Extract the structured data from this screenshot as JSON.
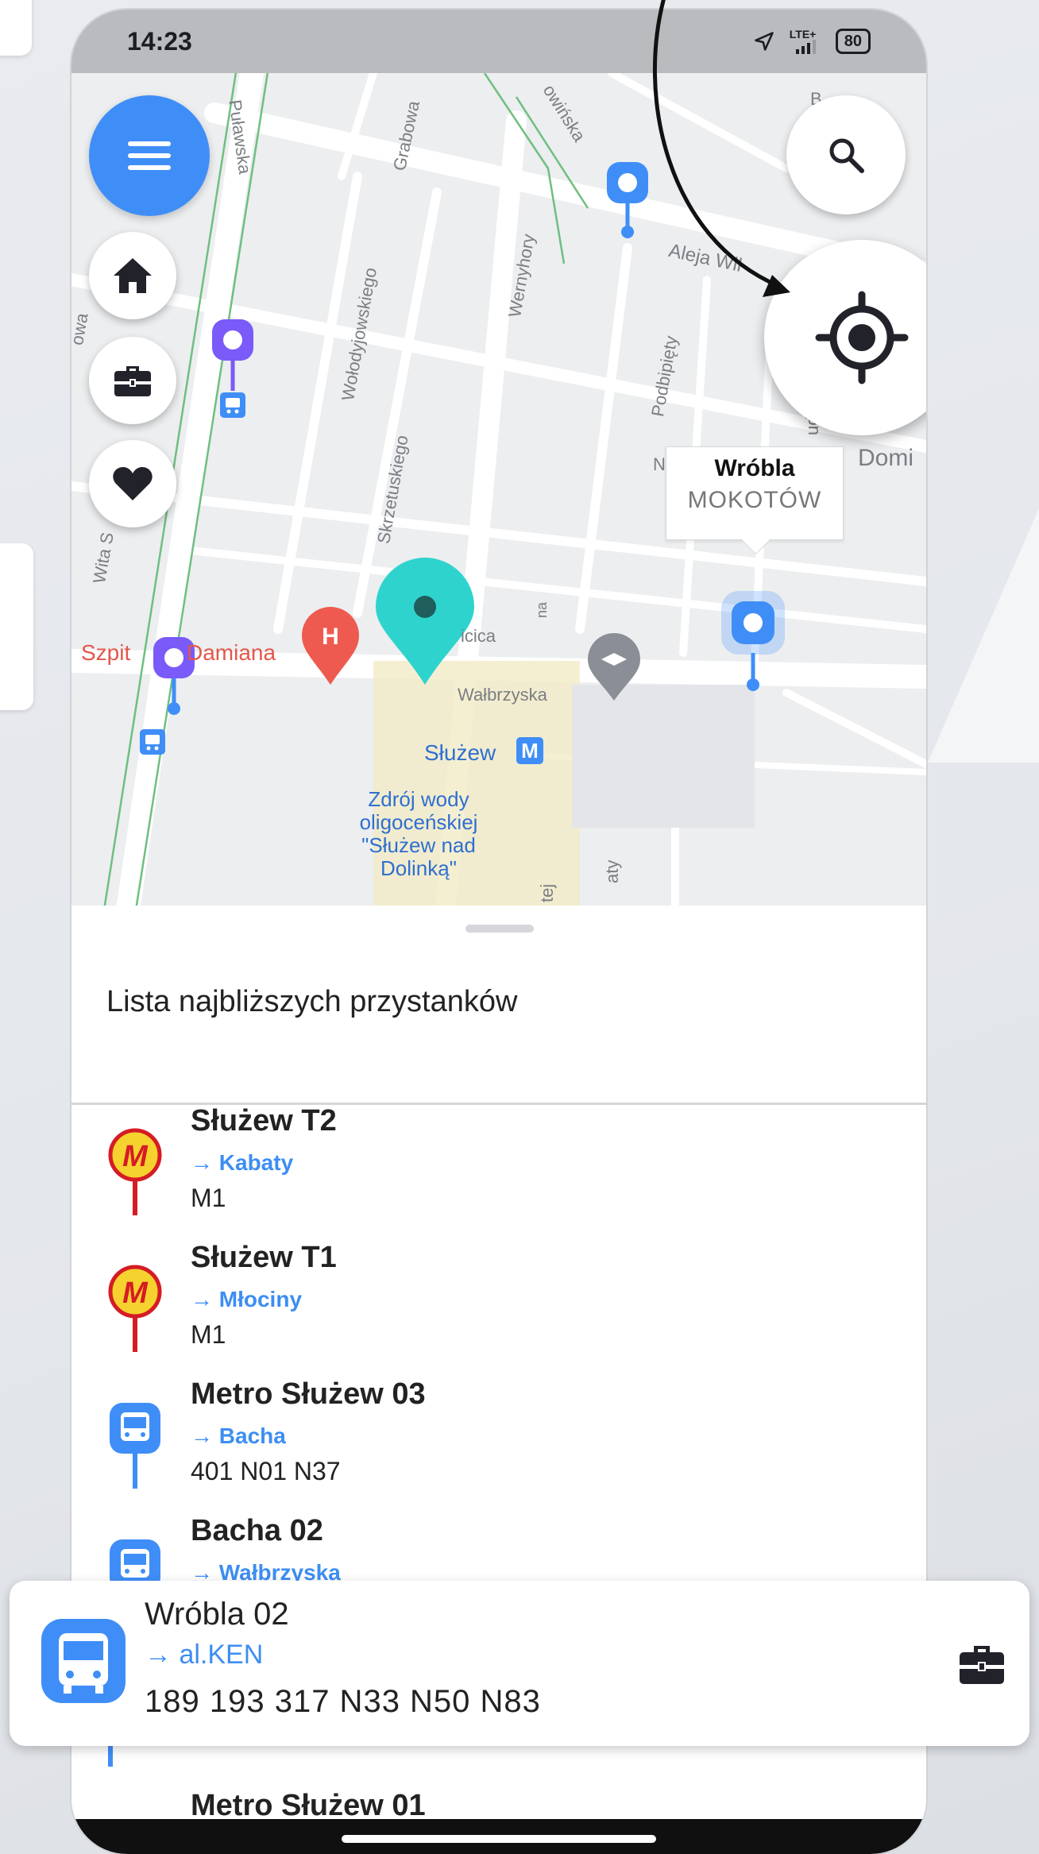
{
  "status_bar": {
    "time": "14:23",
    "network": "LTE+",
    "battery": "80"
  },
  "map": {
    "streets": {
      "pulawska": "Puławska",
      "grabowa": "Grabowa",
      "rowinska": "owińska",
      "aleja": "Aleja Wil",
      "wolodyjowskiego": "Wołodyjowskiego",
      "wernyhory": "Wernyhory",
      "podbipiety": "Podbipięty",
      "skrzetuskiego": "Skrzetuskiego",
      "wita": "Wita S",
      "zowa": "owa",
      "walbrzyska": "Wałbrzyska",
      "cica": "icica",
      "na": "na",
      "tej": "tej",
      "aty": "aty",
      "b": "B",
      "n": "N",
      "ud": "ud"
    },
    "pois": {
      "hospital_a": "Szpit",
      "hospital_b": "Damiana",
      "metro_station": "Służew",
      "fountain": "Zdrój wody oligoceńskiej \"Służew nad Dolinką\"",
      "domi": "Domi"
    },
    "tooltip": {
      "name": "Wróbla",
      "district": "MOKOTÓW"
    },
    "icons": {
      "menu": "menu-icon",
      "home": "home-icon",
      "work": "briefcase-icon",
      "favorites": "heart-icon",
      "search": "search-icon",
      "locate": "locate-icon"
    }
  },
  "sheet": {
    "title": "Lista najbliższych przystanków",
    "stops": [
      {
        "name": "Służew T2",
        "direction": "→ Kabaty",
        "lines": "M1",
        "type": "metro"
      },
      {
        "name": "Służew T1",
        "direction": "→ Młociny",
        "lines": "M1",
        "type": "metro"
      },
      {
        "name": "Metro Służew 03",
        "direction": "→ Bacha",
        "lines": "401 N01 N37",
        "type": "bus"
      },
      {
        "name": "Bacha 02",
        "direction": "→ Wałbrzyska",
        "lines": "",
        "type": "bus"
      },
      {
        "name": "Metro Służew 01",
        "direction": "",
        "lines": "",
        "type": "bus"
      }
    ]
  },
  "floating_card": {
    "name": "Wróbla 02",
    "direction": "→ al.KEN",
    "lines": "189 193 317 N33 N50 N83"
  },
  "colors": {
    "accent": "#3f8ef7",
    "direction_text": "#3d8ef2",
    "metro_yellow": "#f6d22e",
    "metro_red": "#d51c25",
    "pin_purple": "#7a5af8",
    "pin_teal": "#2fd3cd",
    "hospital": "#ee5a4f"
  }
}
